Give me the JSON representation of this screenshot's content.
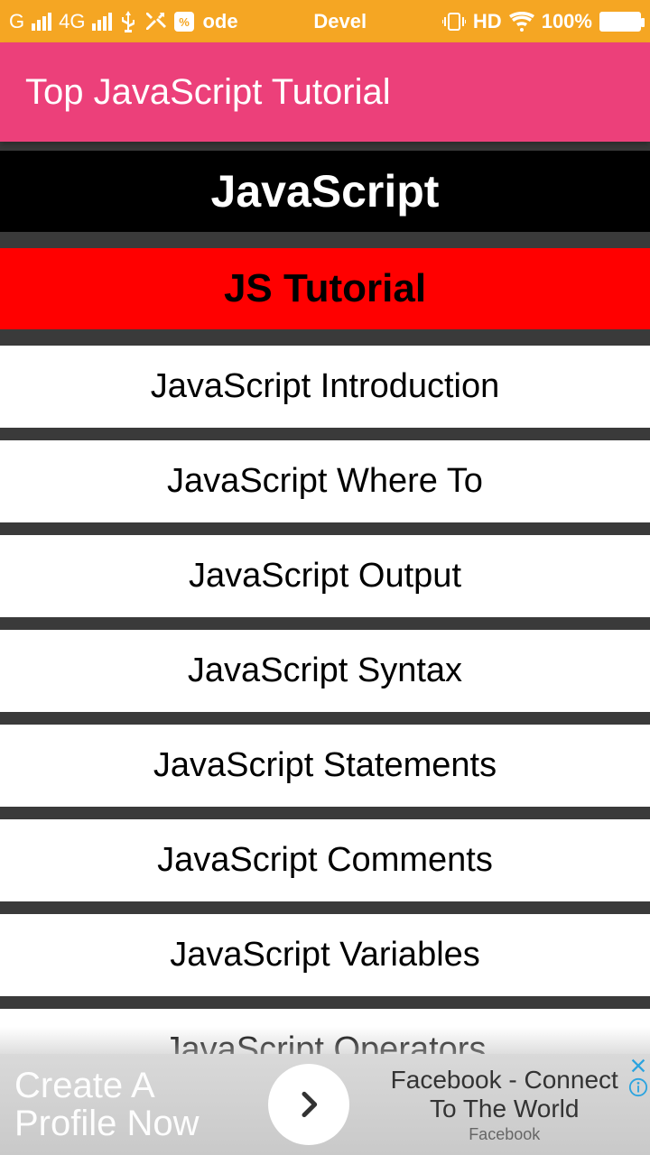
{
  "status": {
    "carrier": "G",
    "network": "4G",
    "app_text": "ode",
    "center": "Devel",
    "hd": "HD",
    "battery": "100%"
  },
  "app_bar": {
    "title": "Top JavaScript Tutorial"
  },
  "main": {
    "header": "JavaScript",
    "section_title": "JS Tutorial",
    "items": [
      "JavaScript Introduction",
      "JavaScript Where To",
      "JavaScript Output",
      "JavaScript Syntax",
      "JavaScript Statements",
      "JavaScript Comments",
      "JavaScript Variables",
      "JavaScript Operators"
    ]
  },
  "ad": {
    "left_line1": "Create A",
    "left_line2": "Profile Now",
    "right_line1": "Facebook - Connect",
    "right_line2": "To The World",
    "right_line3": "Facebook"
  }
}
